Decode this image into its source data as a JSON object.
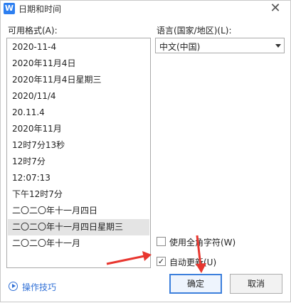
{
  "window": {
    "title": "日期和时间",
    "app_icon_letter": "W",
    "close_glyph": "✕"
  },
  "formats": {
    "label": "可用格式(A):",
    "items": [
      "2020-11-4",
      "2020年11月4日",
      "2020年11月4日星期三",
      "2020/11/4",
      "20.11.4",
      "2020年11月",
      "12时7分13秒",
      "12时7分",
      "12:07:13",
      "下午12时7分",
      "二〇二〇年十一月四日",
      "二〇二〇年十一月四日星期三",
      "二〇二〇年十一月"
    ],
    "selected_index": 11
  },
  "language": {
    "label": "语言(国家/地区)(L):",
    "value": "中文(中国)"
  },
  "options": {
    "fullwidth": {
      "label": "使用全角字符(W)",
      "checked": false
    },
    "auto_update": {
      "label": "自动更新(U)",
      "checked": true
    }
  },
  "tips": {
    "label": "操作技巧"
  },
  "buttons": {
    "ok": "确定",
    "cancel": "取消"
  },
  "colors": {
    "accent": "#3c7fdc",
    "annotation_arrow": "#e8362f"
  }
}
